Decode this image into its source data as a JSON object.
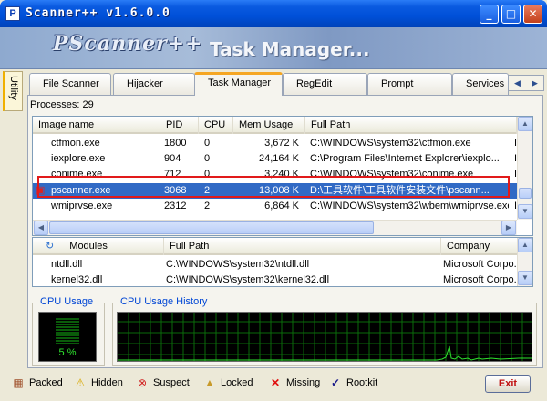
{
  "window": {
    "title": "Scanner++ v1.6.0.0",
    "min": "_",
    "max": "□",
    "close": "✕"
  },
  "banner": {
    "logo": "PScanner++",
    "title": "Task Manager..."
  },
  "side_tab": {
    "label": "Utility"
  },
  "tabs": [
    {
      "label": "File Scanner"
    },
    {
      "label": "Hijacker"
    },
    {
      "label": "Task Manager"
    },
    {
      "label": "RegEdit"
    },
    {
      "label": "Prompt"
    },
    {
      "label": "Services"
    }
  ],
  "processes": {
    "count_label": "Processes: 29",
    "columns": [
      "Image name",
      "PID",
      "CPU",
      "Mem Usage",
      "Full Path"
    ],
    "rows": [
      {
        "name": "ctfmon.exe",
        "pid": "1800",
        "cpu": "0",
        "mem": "3,672 K",
        "path": "C:\\WINDOWS\\system32\\ctfmon.exe",
        "extra": "I"
      },
      {
        "name": "iexplore.exe",
        "pid": "904",
        "cpu": "0",
        "mem": "24,164 K",
        "path": "C:\\Program Files\\Internet Explorer\\iexplo...",
        "extra": "I"
      },
      {
        "name": "conime.exe",
        "pid": "712",
        "cpu": "0",
        "mem": "3,240 K",
        "path": "C:\\WINDOWS\\system32\\conime.exe",
        "extra": "I"
      },
      {
        "name": "pscanner.exe",
        "pid": "3068",
        "cpu": "2",
        "mem": "13,008 K",
        "path": "D:\\工具软件\\工具软件安装文件\\pscann...",
        "extra": ""
      },
      {
        "name": "wmiprvse.exe",
        "pid": "2312",
        "cpu": "2",
        "mem": "6,864 K",
        "path": "C:\\WINDOWS\\system32\\wbem\\wmiprvse.exe",
        "extra": "I"
      }
    ]
  },
  "modules": {
    "columns": [
      "Modules",
      "Full Path",
      "Company"
    ],
    "rows": [
      {
        "name": "ntdll.dll",
        "path": "C:\\WINDOWS\\system32\\ntdll.dll",
        "company": "Microsoft Corpo..."
      },
      {
        "name": "kernel32.dll",
        "path": "C:\\WINDOWS\\system32\\kernel32.dll",
        "company": "Microsoft Corpo..."
      }
    ]
  },
  "cpu": {
    "usage_label": "CPU Usage",
    "history_label": "CPU Usage History",
    "percent": "5 %",
    "level": 0.05
  },
  "legend": {
    "packed": "Packed",
    "hidden": "Hidden",
    "suspect": "Suspect",
    "locked": "Locked",
    "missing": "Missing",
    "rootkit": "Rootkit"
  },
  "exit_label": "Exit",
  "colors": {
    "selection": "#316ac5",
    "highlight_box": "#e11a1a",
    "graph_line": "#2ee22e",
    "graph_grid": "#0a6a0a",
    "exit_text": "#c01010"
  }
}
